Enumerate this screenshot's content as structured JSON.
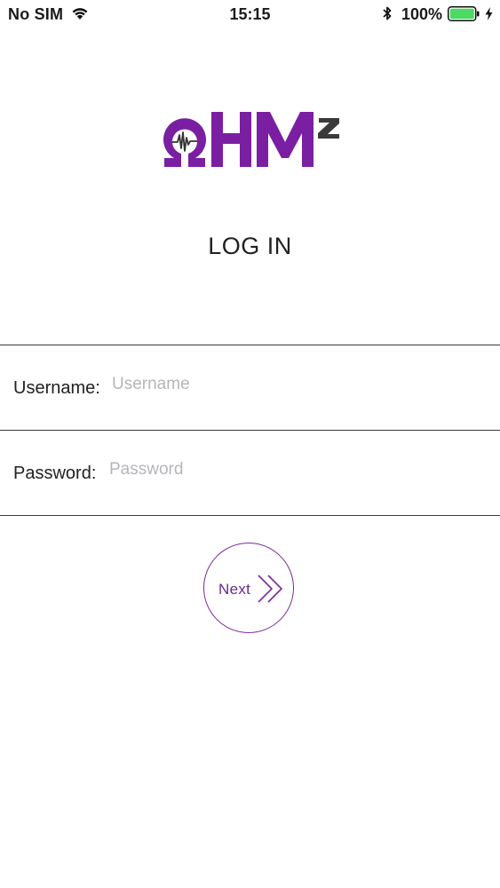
{
  "status_bar": {
    "carrier": "No SIM",
    "time": "15:15",
    "battery_percent": "100%",
    "icons": [
      "wifi-icon",
      "bluetooth-icon",
      "battery-icon",
      "charging-bolt-icon"
    ],
    "battery_color": "#4cd964"
  },
  "logo": {
    "text": "OHMz",
    "primary_color": "#7b1fa2",
    "accent_color": "#3a3a3a"
  },
  "page": {
    "title": "LOG IN"
  },
  "form": {
    "username": {
      "label": "Username:",
      "placeholder": "Username",
      "value": ""
    },
    "password": {
      "label": "Password:",
      "placeholder": "Password",
      "value": ""
    }
  },
  "next_button": {
    "label": "Next",
    "icon": "double-chevron-right-icon",
    "color": "#7a2a99"
  }
}
